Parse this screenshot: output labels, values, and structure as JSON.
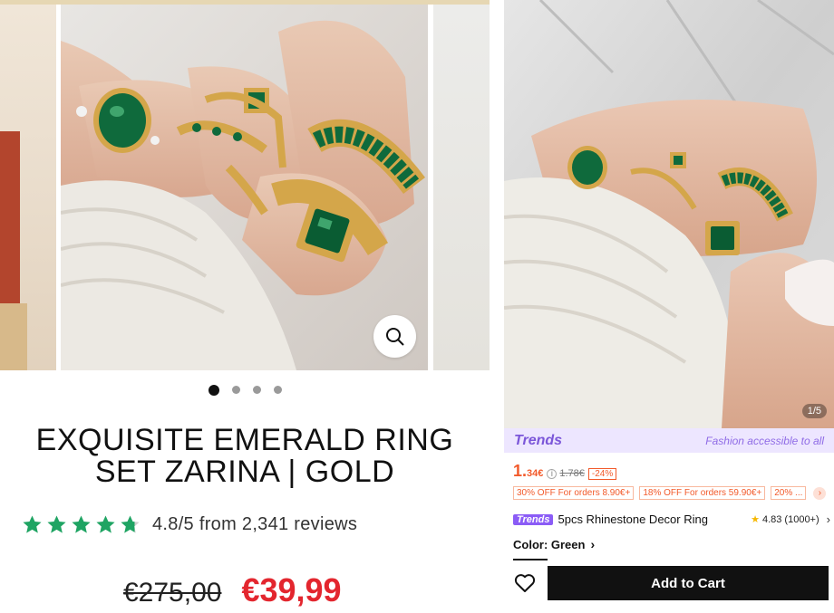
{
  "left": {
    "title_line1": "EXQUISITE EMERALD RING",
    "title_line2": "SET ZARINA | GOLD",
    "rating_text": "4.8/5 from 2,341 reviews",
    "rating_value": 4.8,
    "rating_max": 5,
    "old_price": "€275,00",
    "new_price": "€39,99",
    "carousel_dots": 4,
    "active_dot": 0,
    "star_color": "#1fa463",
    "price_color": "#e3262e",
    "zoom_icon": "search-icon"
  },
  "right": {
    "image_counter": "1/5",
    "trends_logo": "Trends",
    "trends_tagline": "Fashion accessible to all",
    "price_main": "1.",
    "price_small": "34€",
    "original_price": "1.78€",
    "discount": "-24%",
    "coupons": [
      "30% OFF For orders 8.90€+",
      "18% OFF For orders 59.90€+",
      "20% ..."
    ],
    "badge": "Trends",
    "product_name": "5pcs Rhinestone Decor Ring",
    "rating": "4.83",
    "rating_count": "(1000+)",
    "color_label": "Color: Green",
    "add_to_cart": "Add to Cart",
    "accent": "#f25a2b",
    "trends_color": "#7b56d9"
  }
}
